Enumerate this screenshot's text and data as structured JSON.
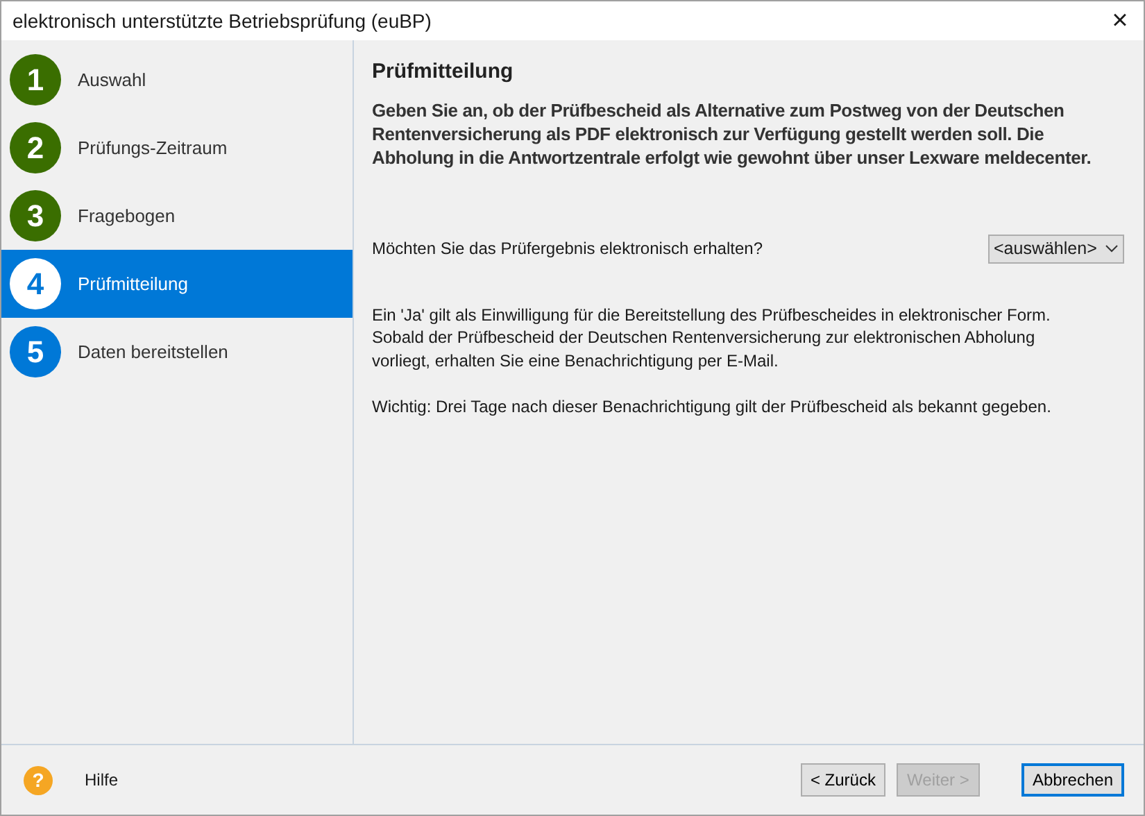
{
  "window": {
    "title": "elektronisch unterstützte Betriebsprüfung (euBP)",
    "close": "×"
  },
  "steps": [
    {
      "number": "1",
      "label": "Auswahl",
      "kind": "done",
      "selected": false
    },
    {
      "number": "2",
      "label": "Prüfungs-Zeitraum",
      "kind": "done",
      "selected": false
    },
    {
      "number": "3",
      "label": "Fragebogen",
      "kind": "done",
      "selected": false
    },
    {
      "number": "4",
      "label": "Prüfmitteilung",
      "kind": "pending",
      "selected": true
    },
    {
      "number": "5",
      "label": "Daten bereitstellen",
      "kind": "pending",
      "selected": false
    }
  ],
  "content": {
    "heading": "Prüfmitteilung",
    "intro": "Geben Sie an, ob der Prüfbescheid als Alternative zum Postweg von der Deutschen Rentenversicherung als PDF elektronisch zur Verfügung gestellt werden soll. Die Abholung in die Antwortzentrale erfolgt wie gewohnt über unser Lexware meldecenter.",
    "question": "Möchten Sie das Prüfergebnis elektronisch erhalten?",
    "select": {
      "value": "<auswählen>"
    },
    "info": "Ein 'Ja' gilt als Einwilligung für die Bereitstellung des Prüfbescheides in elektronischer Form.\nSobald der Prüfbescheid der Deutschen Rentenversicherung zur elektronischen Abholung\nvorliegt, erhalten Sie eine Benachrichtigung per E-Mail.",
    "note": "Wichtig: Drei Tage nach dieser Benachrichtigung gilt der Prüfbescheid als bekannt gegeben."
  },
  "footer": {
    "help_icon": "?",
    "help": "Hilfe",
    "buttons": [
      {
        "label": "< Zurück",
        "disabled": false,
        "default": false
      },
      {
        "label": "Weiter >",
        "disabled": true,
        "default": false
      },
      {
        "label": "Abbrechen",
        "disabled": false,
        "default": true
      }
    ]
  }
}
